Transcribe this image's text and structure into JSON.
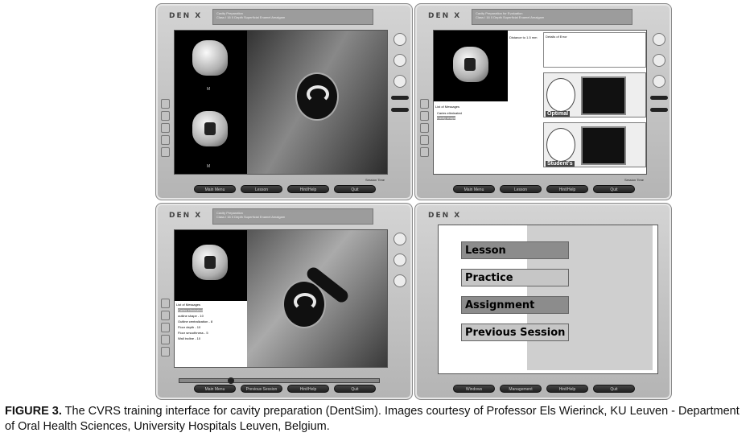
{
  "brand": "DEN X",
  "frames": {
    "practice": {
      "title_line1": "Cavity Preparation",
      "title_line2": "Class I 16 0 Depth Superficial Enamel Amalgam",
      "menu": [
        "Main Menu",
        "Lesson",
        "Hint/Help",
        "Quit"
      ],
      "session": "Session Time",
      "tooth_label": "M"
    },
    "evaluation": {
      "title_line1": "Cavity Preparation for Evaluation",
      "title_line2": "Class I 16 0 Depth Superficial Enamel Amalgam",
      "distance": "Distance to 1.5 mm",
      "details_title": "Details of Error",
      "messages_title": "List of Messages",
      "messages": [
        "Caries eliminated",
        "Cavity shape"
      ],
      "optimal": "Optimal",
      "students": "Student's",
      "menu": [
        "Main Menu",
        "Lesson",
        "Hint/Help",
        "Quit"
      ],
      "session": "Session Time"
    },
    "review": {
      "title_line1": "Cavity Preparation",
      "title_line2": "Class I 16 0 Depth Superficial Enamel Amalgam",
      "messages_title": "List of Messages",
      "messages": [
        "Caries eliminated",
        "outline shape - 10",
        "Outline centralization - 8",
        "Floor depth - 10",
        "Floor smoothness - 5",
        "Wall incline - 10"
      ],
      "menu": [
        "Main Menu",
        "Previous Session",
        "Hint/Help",
        "Quit"
      ]
    },
    "main_menu": {
      "items": [
        "Lesson",
        "Practice",
        "Assignment",
        "Previous Session"
      ],
      "menu": [
        "Windows",
        "Management",
        "Hint/Help",
        "Quit"
      ]
    }
  },
  "caption": {
    "label": "FIGURE 3.",
    "text": " The CVRS training interface for cavity preparation (DentSim). Images courtesy of Professor Els Wierinck, KU Leuven - Department of Oral Health Sciences, University Hospitals Leuven, Belgium."
  }
}
